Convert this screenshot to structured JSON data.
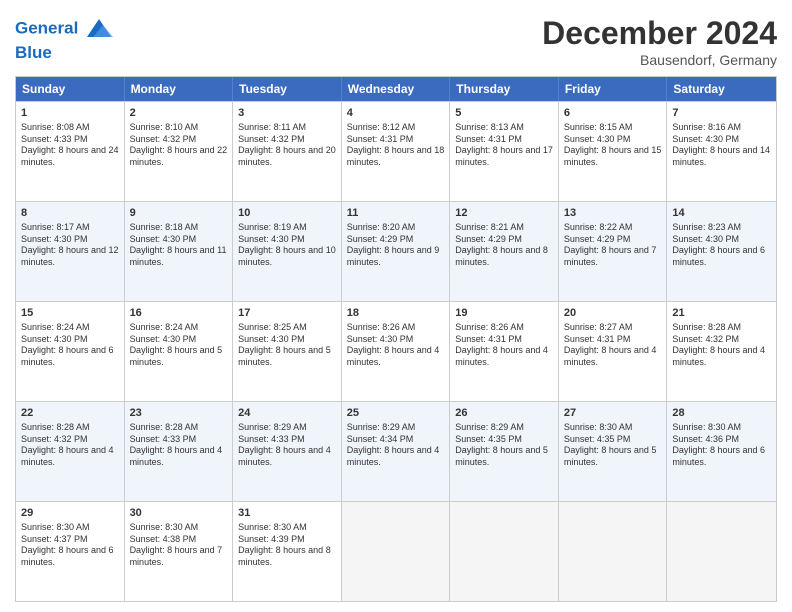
{
  "header": {
    "logo_line1": "General",
    "logo_line2": "Blue",
    "month": "December 2024",
    "location": "Bausendorf, Germany"
  },
  "days_of_week": [
    "Sunday",
    "Monday",
    "Tuesday",
    "Wednesday",
    "Thursday",
    "Friday",
    "Saturday"
  ],
  "weeks": [
    [
      {
        "day": "1",
        "sunrise": "8:08 AM",
        "sunset": "4:33 PM",
        "daylight": "8 hours and 24 minutes."
      },
      {
        "day": "2",
        "sunrise": "8:10 AM",
        "sunset": "4:32 PM",
        "daylight": "8 hours and 22 minutes."
      },
      {
        "day": "3",
        "sunrise": "8:11 AM",
        "sunset": "4:32 PM",
        "daylight": "8 hours and 20 minutes."
      },
      {
        "day": "4",
        "sunrise": "8:12 AM",
        "sunset": "4:31 PM",
        "daylight": "8 hours and 18 minutes."
      },
      {
        "day": "5",
        "sunrise": "8:13 AM",
        "sunset": "4:31 PM",
        "daylight": "8 hours and 17 minutes."
      },
      {
        "day": "6",
        "sunrise": "8:15 AM",
        "sunset": "4:30 PM",
        "daylight": "8 hours and 15 minutes."
      },
      {
        "day": "7",
        "sunrise": "8:16 AM",
        "sunset": "4:30 PM",
        "daylight": "8 hours and 14 minutes."
      }
    ],
    [
      {
        "day": "8",
        "sunrise": "8:17 AM",
        "sunset": "4:30 PM",
        "daylight": "8 hours and 12 minutes."
      },
      {
        "day": "9",
        "sunrise": "8:18 AM",
        "sunset": "4:30 PM",
        "daylight": "8 hours and 11 minutes."
      },
      {
        "day": "10",
        "sunrise": "8:19 AM",
        "sunset": "4:30 PM",
        "daylight": "8 hours and 10 minutes."
      },
      {
        "day": "11",
        "sunrise": "8:20 AM",
        "sunset": "4:29 PM",
        "daylight": "8 hours and 9 minutes."
      },
      {
        "day": "12",
        "sunrise": "8:21 AM",
        "sunset": "4:29 PM",
        "daylight": "8 hours and 8 minutes."
      },
      {
        "day": "13",
        "sunrise": "8:22 AM",
        "sunset": "4:29 PM",
        "daylight": "8 hours and 7 minutes."
      },
      {
        "day": "14",
        "sunrise": "8:23 AM",
        "sunset": "4:30 PM",
        "daylight": "8 hours and 6 minutes."
      }
    ],
    [
      {
        "day": "15",
        "sunrise": "8:24 AM",
        "sunset": "4:30 PM",
        "daylight": "8 hours and 6 minutes."
      },
      {
        "day": "16",
        "sunrise": "8:24 AM",
        "sunset": "4:30 PM",
        "daylight": "8 hours and 5 minutes."
      },
      {
        "day": "17",
        "sunrise": "8:25 AM",
        "sunset": "4:30 PM",
        "daylight": "8 hours and 5 minutes."
      },
      {
        "day": "18",
        "sunrise": "8:26 AM",
        "sunset": "4:30 PM",
        "daylight": "8 hours and 4 minutes."
      },
      {
        "day": "19",
        "sunrise": "8:26 AM",
        "sunset": "4:31 PM",
        "daylight": "8 hours and 4 minutes."
      },
      {
        "day": "20",
        "sunrise": "8:27 AM",
        "sunset": "4:31 PM",
        "daylight": "8 hours and 4 minutes."
      },
      {
        "day": "21",
        "sunrise": "8:28 AM",
        "sunset": "4:32 PM",
        "daylight": "8 hours and 4 minutes."
      }
    ],
    [
      {
        "day": "22",
        "sunrise": "8:28 AM",
        "sunset": "4:32 PM",
        "daylight": "8 hours and 4 minutes."
      },
      {
        "day": "23",
        "sunrise": "8:28 AM",
        "sunset": "4:33 PM",
        "daylight": "8 hours and 4 minutes."
      },
      {
        "day": "24",
        "sunrise": "8:29 AM",
        "sunset": "4:33 PM",
        "daylight": "8 hours and 4 minutes."
      },
      {
        "day": "25",
        "sunrise": "8:29 AM",
        "sunset": "4:34 PM",
        "daylight": "8 hours and 4 minutes."
      },
      {
        "day": "26",
        "sunrise": "8:29 AM",
        "sunset": "4:35 PM",
        "daylight": "8 hours and 5 minutes."
      },
      {
        "day": "27",
        "sunrise": "8:30 AM",
        "sunset": "4:35 PM",
        "daylight": "8 hours and 5 minutes."
      },
      {
        "day": "28",
        "sunrise": "8:30 AM",
        "sunset": "4:36 PM",
        "daylight": "8 hours and 6 minutes."
      }
    ],
    [
      {
        "day": "29",
        "sunrise": "8:30 AM",
        "sunset": "4:37 PM",
        "daylight": "8 hours and 6 minutes."
      },
      {
        "day": "30",
        "sunrise": "8:30 AM",
        "sunset": "4:38 PM",
        "daylight": "8 hours and 7 minutes."
      },
      {
        "day": "31",
        "sunrise": "8:30 AM",
        "sunset": "4:39 PM",
        "daylight": "8 hours and 8 minutes."
      },
      null,
      null,
      null,
      null
    ]
  ],
  "labels": {
    "sunrise": "Sunrise:",
    "sunset": "Sunset:",
    "daylight": "Daylight:"
  }
}
